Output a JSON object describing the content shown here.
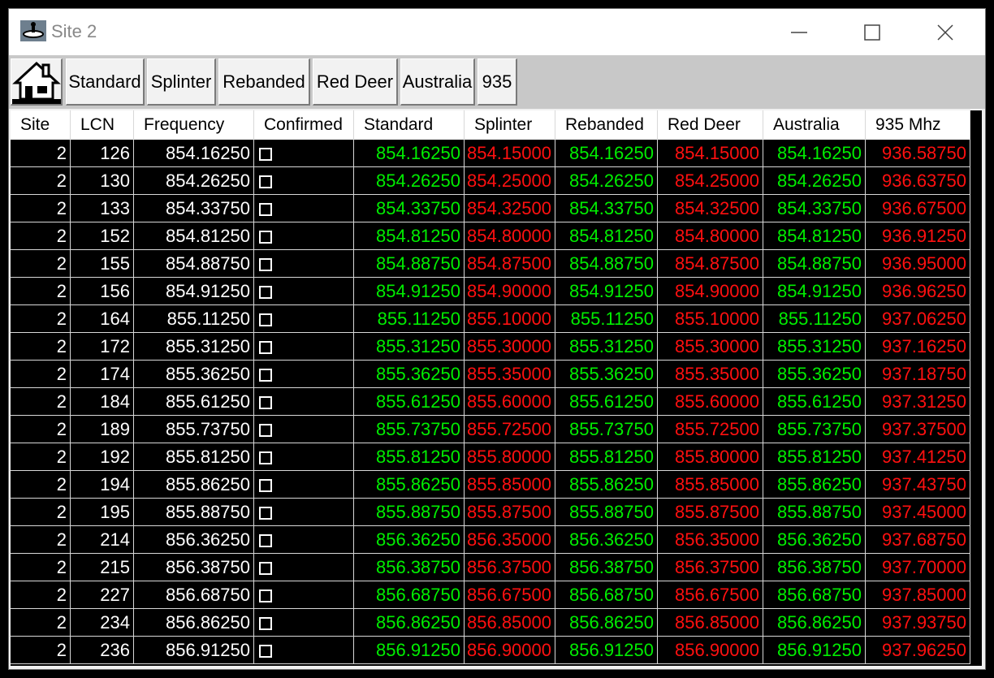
{
  "window": {
    "title": "Site 2"
  },
  "toolbar": {
    "home_icon": "house-icon",
    "buttons": [
      "Standard",
      "Splinter",
      "Rebanded",
      "Red Deer",
      "Australia",
      "935"
    ]
  },
  "colors": {
    "green": "#00ee00",
    "red": "#ff1010",
    "background": "#000000"
  },
  "table": {
    "headers": [
      "Site",
      "LCN",
      "Frequency",
      "Confirmed",
      "Standard",
      "Splinter",
      "Rebanded",
      "Red Deer",
      "Australia",
      "935 Mhz"
    ],
    "rows": [
      {
        "site": "2",
        "lcn": "126",
        "frequency": "854.16250",
        "confirmed": false,
        "standard": "854.16250",
        "splinter": "854.15000",
        "rebanded": "854.16250",
        "red_deer": "854.15000",
        "australia": "854.16250",
        "mhz935": "936.58750"
      },
      {
        "site": "2",
        "lcn": "130",
        "frequency": "854.26250",
        "confirmed": false,
        "standard": "854.26250",
        "splinter": "854.25000",
        "rebanded": "854.26250",
        "red_deer": "854.25000",
        "australia": "854.26250",
        "mhz935": "936.63750"
      },
      {
        "site": "2",
        "lcn": "133",
        "frequency": "854.33750",
        "confirmed": false,
        "standard": "854.33750",
        "splinter": "854.32500",
        "rebanded": "854.33750",
        "red_deer": "854.32500",
        "australia": "854.33750",
        "mhz935": "936.67500"
      },
      {
        "site": "2",
        "lcn": "152",
        "frequency": "854.81250",
        "confirmed": false,
        "standard": "854.81250",
        "splinter": "854.80000",
        "rebanded": "854.81250",
        "red_deer": "854.80000",
        "australia": "854.81250",
        "mhz935": "936.91250"
      },
      {
        "site": "2",
        "lcn": "155",
        "frequency": "854.88750",
        "confirmed": false,
        "standard": "854.88750",
        "splinter": "854.87500",
        "rebanded": "854.88750",
        "red_deer": "854.87500",
        "australia": "854.88750",
        "mhz935": "936.95000"
      },
      {
        "site": "2",
        "lcn": "156",
        "frequency": "854.91250",
        "confirmed": false,
        "standard": "854.91250",
        "splinter": "854.90000",
        "rebanded": "854.91250",
        "red_deer": "854.90000",
        "australia": "854.91250",
        "mhz935": "936.96250"
      },
      {
        "site": "2",
        "lcn": "164",
        "frequency": "855.11250",
        "confirmed": false,
        "standard": "855.11250",
        "splinter": "855.10000",
        "rebanded": "855.11250",
        "red_deer": "855.10000",
        "australia": "855.11250",
        "mhz935": "937.06250"
      },
      {
        "site": "2",
        "lcn": "172",
        "frequency": "855.31250",
        "confirmed": false,
        "standard": "855.31250",
        "splinter": "855.30000",
        "rebanded": "855.31250",
        "red_deer": "855.30000",
        "australia": "855.31250",
        "mhz935": "937.16250"
      },
      {
        "site": "2",
        "lcn": "174",
        "frequency": "855.36250",
        "confirmed": false,
        "standard": "855.36250",
        "splinter": "855.35000",
        "rebanded": "855.36250",
        "red_deer": "855.35000",
        "australia": "855.36250",
        "mhz935": "937.18750"
      },
      {
        "site": "2",
        "lcn": "184",
        "frequency": "855.61250",
        "confirmed": false,
        "standard": "855.61250",
        "splinter": "855.60000",
        "rebanded": "855.61250",
        "red_deer": "855.60000",
        "australia": "855.61250",
        "mhz935": "937.31250"
      },
      {
        "site": "2",
        "lcn": "189",
        "frequency": "855.73750",
        "confirmed": false,
        "standard": "855.73750",
        "splinter": "855.72500",
        "rebanded": "855.73750",
        "red_deer": "855.72500",
        "australia": "855.73750",
        "mhz935": "937.37500"
      },
      {
        "site": "2",
        "lcn": "192",
        "frequency": "855.81250",
        "confirmed": false,
        "standard": "855.81250",
        "splinter": "855.80000",
        "rebanded": "855.81250",
        "red_deer": "855.80000",
        "australia": "855.81250",
        "mhz935": "937.41250"
      },
      {
        "site": "2",
        "lcn": "194",
        "frequency": "855.86250",
        "confirmed": false,
        "standard": "855.86250",
        "splinter": "855.85000",
        "rebanded": "855.86250",
        "red_deer": "855.85000",
        "australia": "855.86250",
        "mhz935": "937.43750"
      },
      {
        "site": "2",
        "lcn": "195",
        "frequency": "855.88750",
        "confirmed": false,
        "standard": "855.88750",
        "splinter": "855.87500",
        "rebanded": "855.88750",
        "red_deer": "855.87500",
        "australia": "855.88750",
        "mhz935": "937.45000"
      },
      {
        "site": "2",
        "lcn": "214",
        "frequency": "856.36250",
        "confirmed": false,
        "standard": "856.36250",
        "splinter": "856.35000",
        "rebanded": "856.36250",
        "red_deer": "856.35000",
        "australia": "856.36250",
        "mhz935": "937.68750"
      },
      {
        "site": "2",
        "lcn": "215",
        "frequency": "856.38750",
        "confirmed": false,
        "standard": "856.38750",
        "splinter": "856.37500",
        "rebanded": "856.38750",
        "red_deer": "856.37500",
        "australia": "856.38750",
        "mhz935": "937.70000"
      },
      {
        "site": "2",
        "lcn": "227",
        "frequency": "856.68750",
        "confirmed": false,
        "standard": "856.68750",
        "splinter": "856.67500",
        "rebanded": "856.68750",
        "red_deer": "856.67500",
        "australia": "856.68750",
        "mhz935": "937.85000"
      },
      {
        "site": "2",
        "lcn": "234",
        "frequency": "856.86250",
        "confirmed": false,
        "standard": "856.86250",
        "splinter": "856.85000",
        "rebanded": "856.86250",
        "red_deer": "856.85000",
        "australia": "856.86250",
        "mhz935": "937.93750"
      },
      {
        "site": "2",
        "lcn": "236",
        "frequency": "856.91250",
        "confirmed": false,
        "standard": "856.91250",
        "splinter": "856.90000",
        "rebanded": "856.91250",
        "red_deer": "856.90000",
        "australia": "856.91250",
        "mhz935": "937.96250"
      }
    ]
  }
}
